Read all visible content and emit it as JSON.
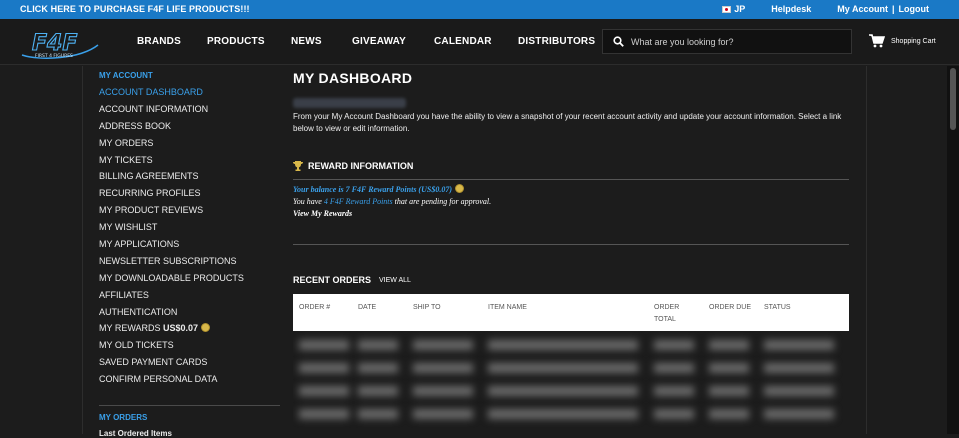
{
  "topbar": {
    "promo": "CLICK HERE TO PURCHASE F4F LIFE PRODUCTS!!!",
    "lang": "JP",
    "helpdesk": "Helpdesk",
    "my_account": "My Account",
    "separator": "|",
    "logout": "Logout"
  },
  "brand": {
    "logo_icon": "f4f-logo",
    "logo_text": "F4F",
    "logo_sub": "FIRST 4 FIGURES"
  },
  "nav": {
    "items": [
      "BRANDS",
      "PRODUCTS",
      "NEWS",
      "GIVEAWAY",
      "CALENDAR",
      "DISTRIBUTORS"
    ],
    "search_placeholder": "What are you looking for?",
    "cart_label": "Shopping Cart"
  },
  "sidebar": {
    "heading": "MY ACCOUNT",
    "items": [
      "ACCOUNT DASHBOARD",
      "ACCOUNT INFORMATION",
      "ADDRESS BOOK",
      "MY ORDERS",
      "MY TICKETS",
      "BILLING AGREEMENTS",
      "RECURRING PROFILES",
      "MY PRODUCT REVIEWS",
      "MY WISHLIST",
      "MY APPLICATIONS",
      "NEWSLETTER SUBSCRIPTIONS",
      "MY DOWNLOADABLE PRODUCTS",
      "AFFILIATES",
      "AUTHENTICATION",
      "MY REWARDS",
      "MY OLD TICKETS",
      "SAVED PAYMENT CARDS",
      "CONFIRM PERSONAL DATA"
    ],
    "rewards_amount": "US$0.07",
    "orders_heading": "MY ORDERS",
    "last_ordered": "Last Ordered Items"
  },
  "main": {
    "title": "MY DASHBOARD",
    "intro": "From your My Account Dashboard you have the ability to view a snapshot of your recent account activity and update your account information. Select a link below to view or edit information.",
    "reward": {
      "title": "REWARD INFORMATION",
      "balance": "Your balance is 7 F4F Reward Points (US$0.07)",
      "pending_pre": "You have ",
      "pending_link": "4 F4F Reward Points",
      "pending_post": " that are pending for approval.",
      "view": "View My Rewards"
    },
    "orders": {
      "title": "RECENT ORDERS",
      "view_all": "VIEW ALL",
      "columns": [
        "ORDER #",
        "DATE",
        "SHIP TO",
        "ITEM NAME",
        "ORDER TOTAL",
        "ORDER DUE",
        "STATUS"
      ]
    }
  }
}
